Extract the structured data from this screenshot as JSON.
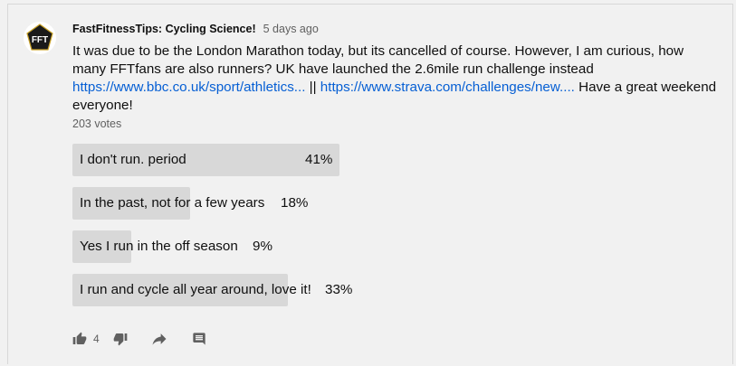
{
  "post": {
    "author": "FastFitnessTips: Cycling Science!",
    "time": "5 days ago",
    "avatar_text": "FFT",
    "text_before": "It was due to be the London Marathon today, but its cancelled of course. However, I am curious, how many FFTfans are also runners? UK have launched the 2.6mile run challenge instead ",
    "link1": "https://www.bbc.co.uk/sport/athletics...",
    "separator": " || ",
    "link2": "https://www.strava.com/challenges/new....",
    "text_after": " Have a great weekend everyone!",
    "votes": "203 votes"
  },
  "poll": {
    "options": [
      {
        "label": "I don't run. period",
        "percent_text": "41%",
        "percent": 41
      },
      {
        "label": "In the past, not for a few years",
        "percent_text": "18%",
        "percent": 18
      },
      {
        "label": "Yes I run in the off season",
        "percent_text": "9%",
        "percent": 9
      },
      {
        "label": "I run and cycle all year around, love it!",
        "percent_text": "33%",
        "percent": 33
      }
    ]
  },
  "actions": {
    "like_count": "4",
    "icons": [
      "thumbs-up-icon",
      "thumbs-down-icon",
      "share-icon",
      "comment-icon"
    ]
  },
  "colors": {
    "background": "#f1f1f1",
    "bar_fill": "#d8d8d8",
    "link": "#065fd4",
    "secondary_text": "#606060"
  }
}
